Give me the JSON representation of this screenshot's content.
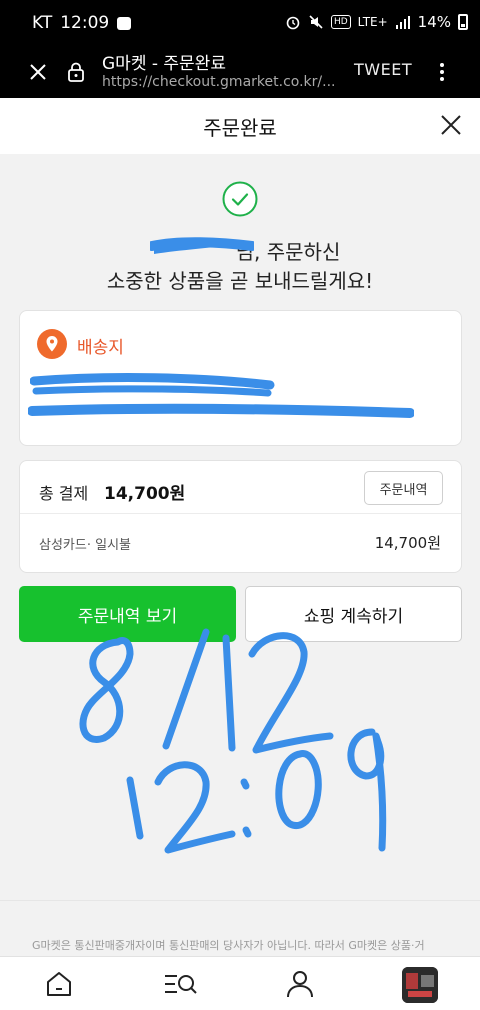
{
  "status_bar": {
    "carrier": "KT",
    "time": "12:09",
    "network": "LTE+",
    "hd": "HD",
    "battery": "14%"
  },
  "browser": {
    "title": "G마켓 - 주문완료",
    "url": "https://checkout.gmarket.co.kr/...",
    "tweet_label": "TWEET"
  },
  "header": {
    "title": "주문완료"
  },
  "confirmation": {
    "line1": "님, 주문하신",
    "line2": "소중한 상품을 곧 보내드릴게요!"
  },
  "address": {
    "label": "배송지"
  },
  "payment": {
    "total_label": "총 결제",
    "total_value": "14,700원",
    "detail_button": "주문내역",
    "method": "삼성카드· 일시불",
    "amount": "14,700원"
  },
  "actions": {
    "view_orders": "주문내역 보기",
    "continue_shopping": "쇼핑 계속하기"
  },
  "footer": {
    "notice": "G마켓은 통신판매중개자이며 통신판매의 당사자가 아닙니다. 따라서 G마켓은 상품·거"
  },
  "bottom_nav": {
    "items": [
      "home-icon",
      "category-search-icon",
      "my-page-icon",
      "recent-item-thumbnail"
    ]
  },
  "colors": {
    "accent_green": "#17c12e",
    "address_orange": "#e8582b",
    "check_green": "#1fb14a",
    "handwriting_blue": "#3a8ee8"
  }
}
